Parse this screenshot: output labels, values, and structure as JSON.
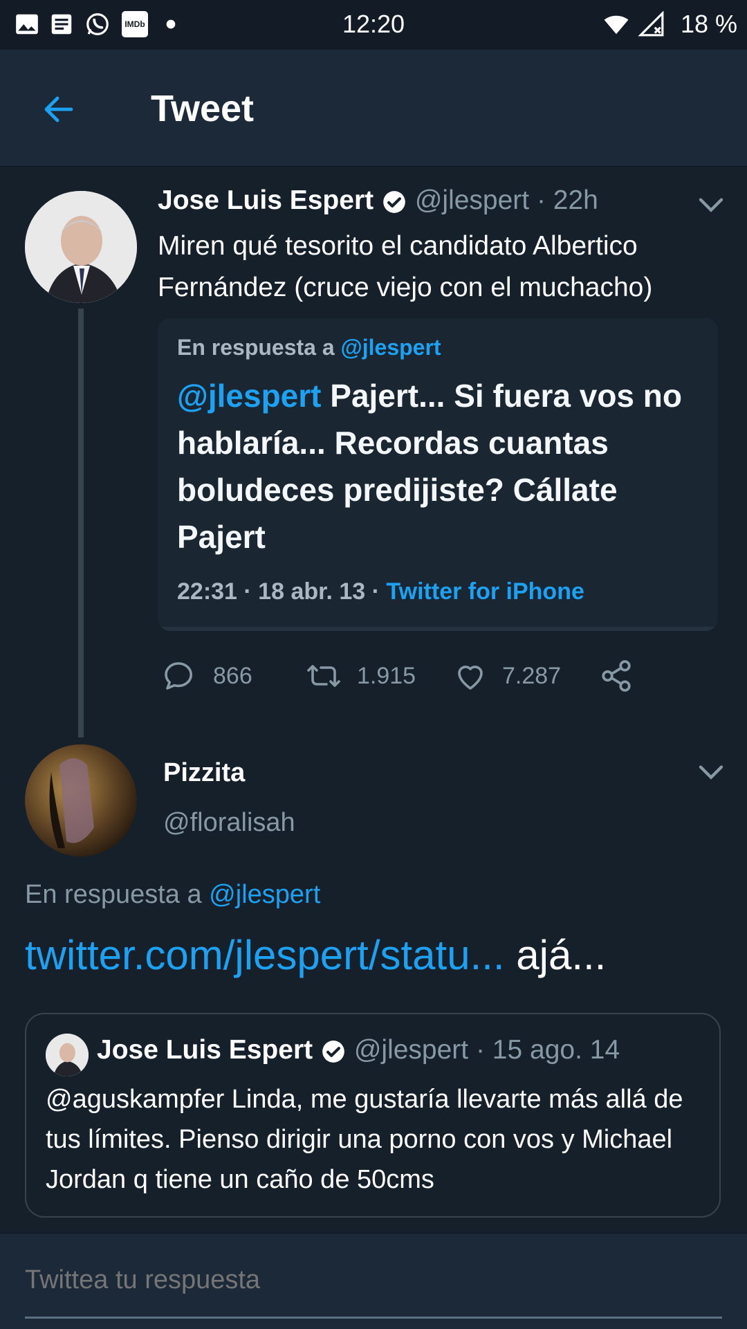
{
  "status_bar": {
    "time": "12:20",
    "battery": "18 %",
    "left_icons": [
      "gallery-icon",
      "news-icon",
      "whatsapp-icon",
      "imdb-icon",
      "dot-icon"
    ],
    "imdb_label": "IMDb",
    "right_icons": [
      "wifi-icon",
      "signal-icon"
    ]
  },
  "header": {
    "title": "Tweet"
  },
  "tweet": {
    "author": "Jose Luis Espert",
    "handle": "@jlespert",
    "time": "· 22h",
    "text": "Miren qué tesorito el candidato Albertico Fernández (cruce viejo con el muchacho)",
    "image": {
      "reply_prefix": "En respuesta a",
      "reply_handle": "@jlespert",
      "mention": "@jlespert",
      "body": " Pajert... Si fuera vos no hablaría... Recordas cuantas boludeces predijiste? Cállate Pajert",
      "meta": "22:31 · 18 abr. 13 · ",
      "source": "Twitter for iPhone"
    },
    "actions": {
      "replies": "866",
      "retweets": "1.915",
      "likes": "7.287"
    }
  },
  "reply_tweet": {
    "author": "Pizzita",
    "handle": "@floralisah",
    "reply_prefix": "En respuesta a ",
    "reply_handle": "@jlespert",
    "link": "twitter.com/jlespert/statu...",
    "text_after": " ajá..."
  },
  "quoted": {
    "author": "Jose Luis Espert",
    "handle": "@jlespert",
    "time": "· 15 ago. 14",
    "text": "@aguskampfer Linda, me gustaría llevarte más allá de tus límites. Pienso dirigir una porno con vos y Michael Jordan q tiene un caño de 50cms"
  },
  "reply_bar": {
    "placeholder": "Twittea tu respuesta"
  },
  "colors": {
    "background": "#15202b",
    "header": "#1c2938",
    "accent": "#1da1f2",
    "muted": "#8899a6",
    "border": "#38444d"
  }
}
